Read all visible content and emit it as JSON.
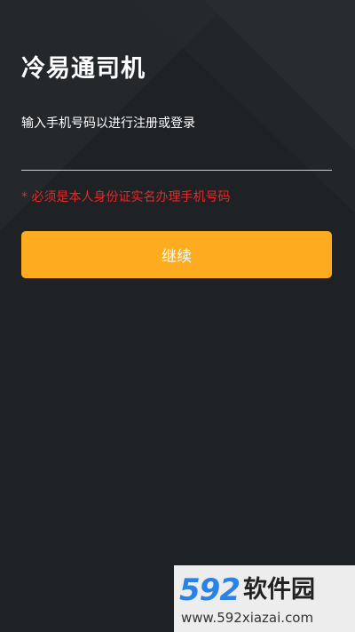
{
  "app": {
    "title": "冷易通司机"
  },
  "login": {
    "subtitle": "输入手机号码以进行注册或登录",
    "phone_value": "",
    "notice": "* 必须是本人身份证实名办理手机号码",
    "continue_label": "继续"
  },
  "watermark": {
    "logo_number": "592",
    "logo_text": "软件园",
    "url": "www.592xiazai.com"
  },
  "colors": {
    "background": "#1f2225",
    "accent": "#fdab1f",
    "warning": "#e02a2a"
  }
}
